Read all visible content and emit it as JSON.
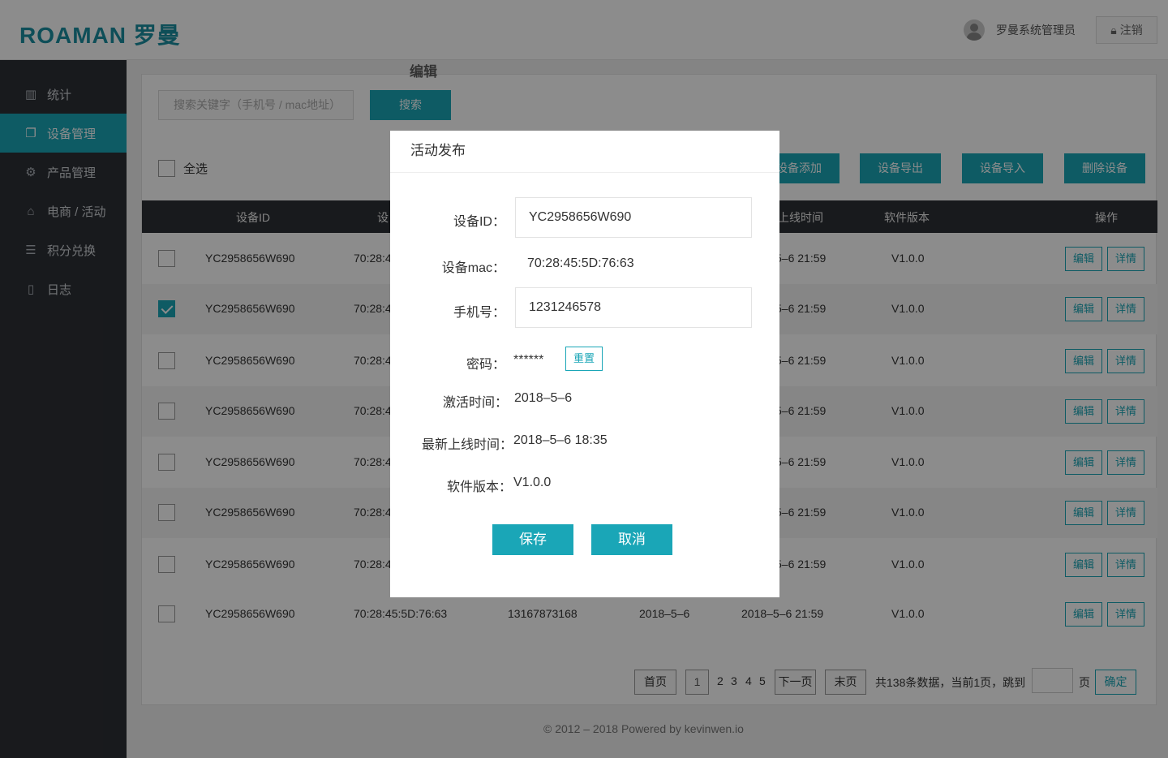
{
  "header": {
    "logo": "ROAMAN 罗曼",
    "user_name": "罗曼系统管理员",
    "logout_label": "注销"
  },
  "sidebar": {
    "items": [
      {
        "label": "统计",
        "icon": "bar-chart-icon"
      },
      {
        "label": "设备管理",
        "icon": "devices-icon",
        "active": true
      },
      {
        "label": "产品管理",
        "icon": "gear-icon"
      },
      {
        "label": "电商 / 活动",
        "icon": "store-icon"
      },
      {
        "label": "积分兑换",
        "icon": "database-icon"
      },
      {
        "label": "日志",
        "icon": "clipboard-icon"
      }
    ]
  },
  "toolbar": {
    "search_placeholder": "搜索关键字（手机号 / mac地址）",
    "search_label": "搜索",
    "floating_label": "编辑",
    "select_all": "全选",
    "add_label": "设备添加",
    "export_label": "设备导出",
    "import_label": "设备导入",
    "delete_label": "删除设备"
  },
  "table": {
    "headers": {
      "device_id": "设备ID",
      "mac": "设",
      "online": "上线时间",
      "version": "软件版本",
      "action": "操作"
    },
    "rows": [
      {
        "id": "YC2958656W690",
        "mac": "70:28:4",
        "online": "5–6  21:59",
        "version": "V1.0.0",
        "checked": false
      },
      {
        "id": "YC2958656W690",
        "mac": "70:28:4",
        "online": "5–6  21:59",
        "version": "V1.0.0",
        "checked": true
      },
      {
        "id": "YC2958656W690",
        "mac": "70:28:4",
        "online": "5–6  21:59",
        "version": "V1.0.0",
        "checked": false
      },
      {
        "id": "YC2958656W690",
        "mac": "70:28:4",
        "online": "5–6  21:59",
        "version": "V1.0.0",
        "checked": false
      },
      {
        "id": "YC2958656W690",
        "mac": "70:28:4",
        "online": "5–6  21:59",
        "version": "V1.0.0",
        "checked": false
      },
      {
        "id": "YC2958656W690",
        "mac": "70:28:4",
        "online": "5–6  21:59",
        "version": "V1.0.0",
        "checked": false
      },
      {
        "id": "YC2958656W690",
        "mac": "70:28:4",
        "online": "5–6  21:59",
        "version": "V1.0.0",
        "checked": false
      }
    ],
    "last_row": {
      "id": "YC2958656W690",
      "mac": "70:28:45:5D:76:63",
      "phone": "13167873168",
      "activated": "2018–5–6",
      "online": "2018–5–6  21:59",
      "version": "V1.0.0"
    },
    "edit_label": "编辑",
    "detail_label": "详情"
  },
  "pagination": {
    "first": "首页",
    "current": "1",
    "pages": [
      "2",
      "3",
      "4",
      "5"
    ],
    "next": "下一页",
    "last": "末页",
    "summary": "共138条数据，当前1页，跳到",
    "page_unit": "页",
    "confirm": "确定"
  },
  "footer": "© 2012 – 2018 Powered by kevinwen.io",
  "modal": {
    "title": "活动发布",
    "device_id_label": "设备ID：",
    "device_id": "YC2958656W690",
    "mac_label": "设备mac：",
    "mac": "70:28:45:5D:76:63",
    "phone_label": "手机号：",
    "phone": "1231246578",
    "password_label": "密码：",
    "password": "******",
    "reset_label": "重置",
    "activated_label": "激活时间：",
    "activated": "2018–5–6",
    "online_label": "最新上线时间：",
    "online": "2018–5–6 18:35",
    "version_label": "软件版本：",
    "version": "V1.0.0",
    "save_label": "保存",
    "cancel_label": "取消"
  }
}
